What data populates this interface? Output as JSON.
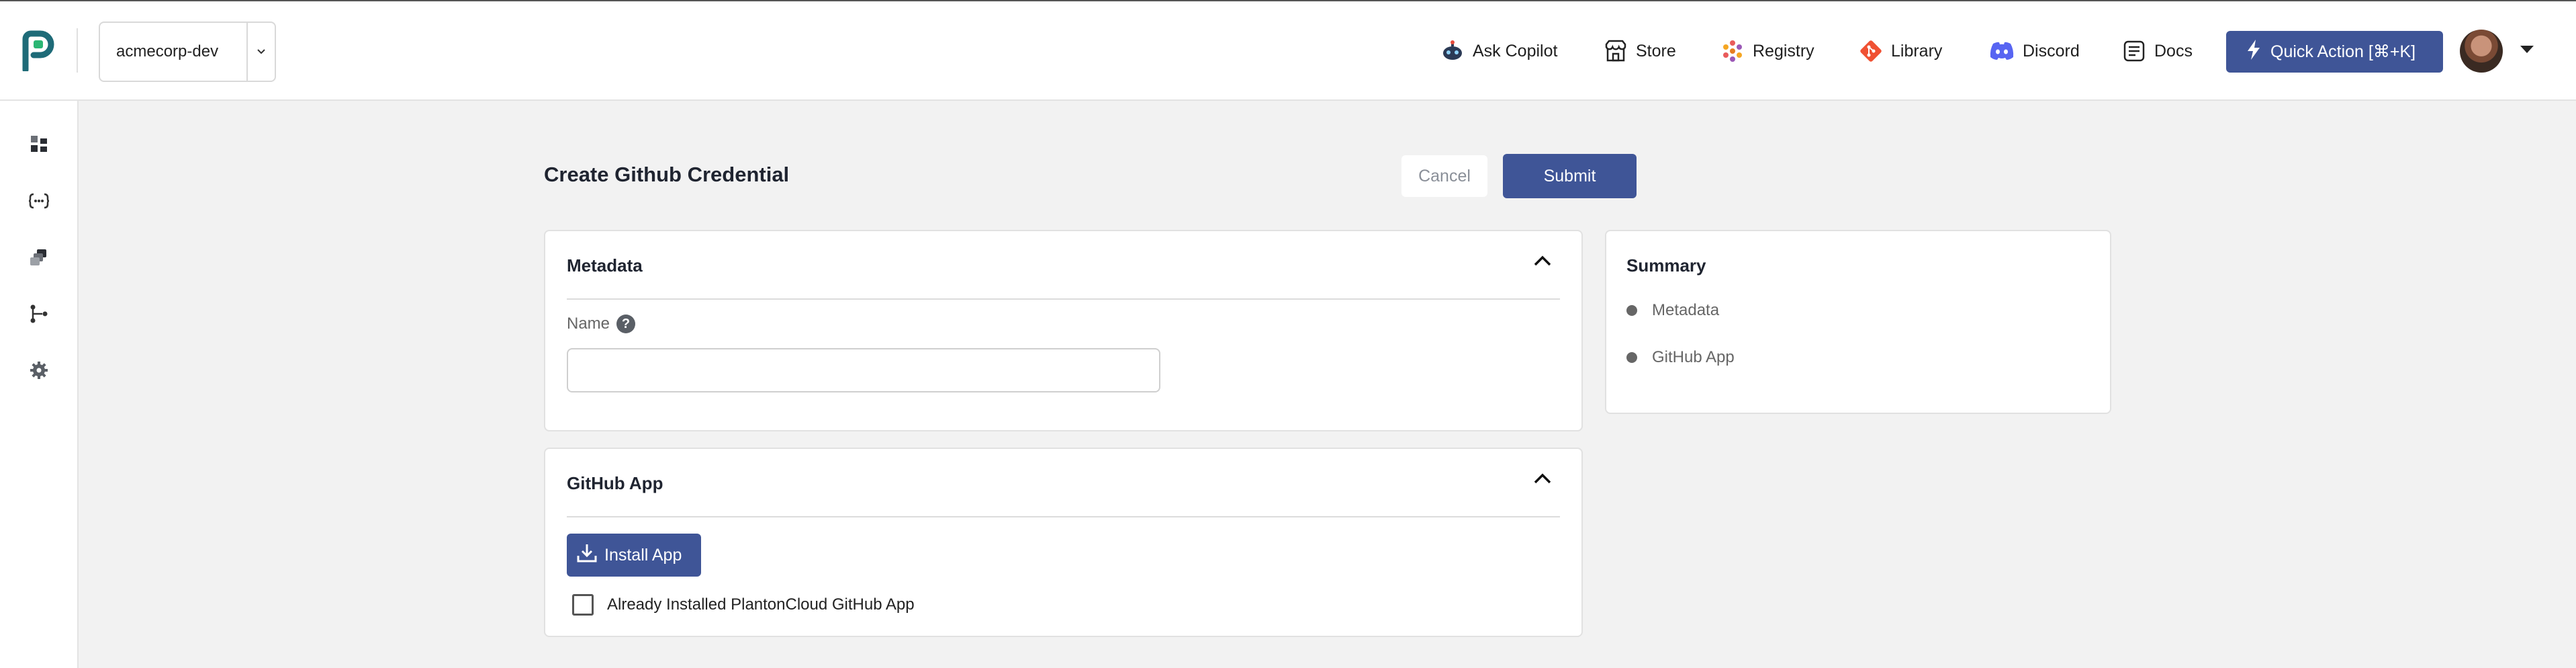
{
  "header": {
    "org_name": "acmecorp-dev",
    "nav": [
      {
        "label": "Ask Copilot",
        "icon": "copilot-icon"
      },
      {
        "label": "Store",
        "icon": "store-icon"
      },
      {
        "label": "Registry",
        "icon": "registry-icon"
      },
      {
        "label": "Library",
        "icon": "git-icon"
      },
      {
        "label": "Discord",
        "icon": "discord-icon"
      },
      {
        "label": "Docs",
        "icon": "docs-icon"
      }
    ],
    "quick_action_label": "Quick Action [⌘+K]"
  },
  "sidebar": {
    "icons": [
      "dashboard-icon",
      "api-icon",
      "stacks-icon",
      "flow-icon",
      "settings-icon"
    ]
  },
  "page": {
    "title": "Create Github Credential",
    "cancel_label": "Cancel",
    "submit_label": "Submit"
  },
  "metadata": {
    "title": "Metadata",
    "name_label": "Name",
    "name_value": "",
    "name_placeholder": ""
  },
  "github_app": {
    "title": "GitHub App",
    "install_label": "Install App",
    "checkbox_label": "Already Installed PlantonCloud GitHub App"
  },
  "summary": {
    "title": "Summary",
    "items": [
      "Metadata",
      "GitHub App"
    ]
  },
  "colors": {
    "primary": "#3f5597",
    "background": "#f2f2f2",
    "logo_teal": "#1e6b78",
    "logo_green": "#2bb673"
  }
}
